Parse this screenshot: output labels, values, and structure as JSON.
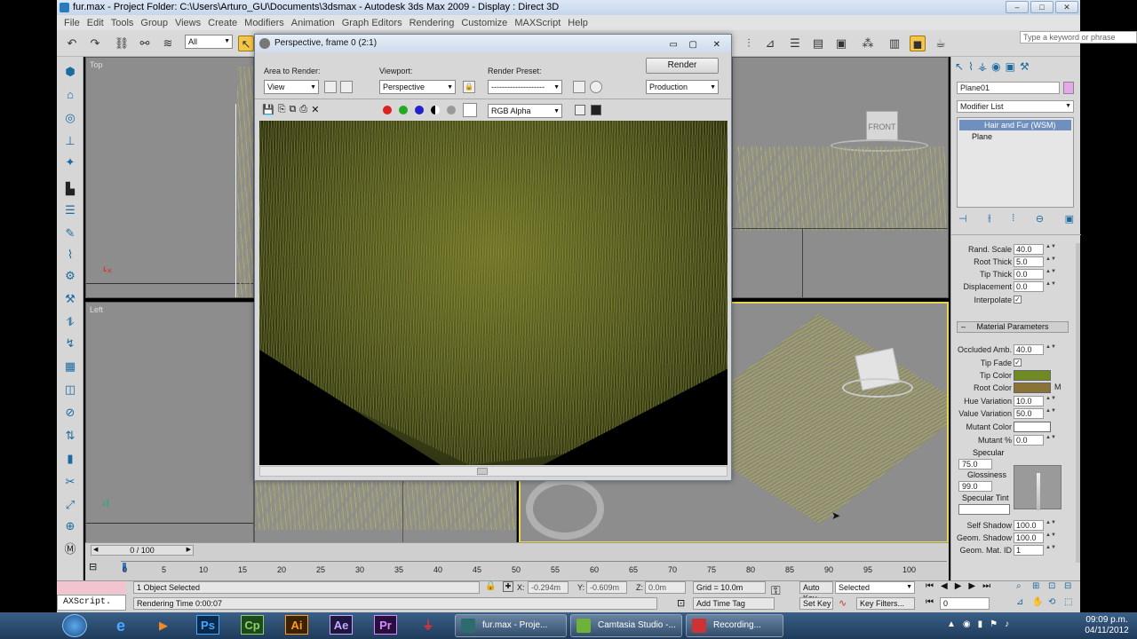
{
  "app": {
    "title": "fur.max     - Project Folder: C:\\Users\\Arturo_GU\\Documents\\3dsmax     - Autodesk 3ds Max  2009       - Display : Direct 3D"
  },
  "menu": [
    "File",
    "Edit",
    "Tools",
    "Group",
    "Views",
    "Create",
    "Modifiers",
    "Animation",
    "Graph Editors",
    "Rendering",
    "Customize",
    "MAXScript",
    "Help"
  ],
  "toolbar": {
    "selection_filter": "All",
    "search_placeholder": "Type a keyword or phrase"
  },
  "viewports": {
    "top_label": "Top",
    "left_label": "Left",
    "front_cube": "FRONT"
  },
  "render_window": {
    "title": "Perspective, frame 0 (2:1)",
    "area_label": "Area to Render:",
    "area_value": "View",
    "viewport_label": "Viewport:",
    "viewport_value": "Perspective",
    "preset_label": "Render Preset:",
    "preset_value": "--------------------",
    "render_button": "Render",
    "production_value": "Production",
    "channel_value": "RGB Alpha"
  },
  "command_panel": {
    "object_name": "Plane01",
    "modifier_list": "Modifier List",
    "stack": [
      "Hair and Fur (WSM)",
      "Plane"
    ],
    "params": [
      {
        "label": "Rand. Scale",
        "value": "40.0"
      },
      {
        "label": "Root Thick",
        "value": "5.0"
      },
      {
        "label": "Tip Thick",
        "value": "0.0"
      },
      {
        "label": "Displacement",
        "value": "0.0"
      }
    ],
    "interpolate_label": "Interpolate",
    "rollout_title": "Material Parameters",
    "occluded_label": "Occluded Amb.",
    "occluded_value": "40.0",
    "tip_fade_label": "Tip Fade",
    "tip_color_label": "Tip Color",
    "root_color_label": "Root Color",
    "root_color_map": "M",
    "hue_label": "Hue Variation",
    "hue_value": "10.0",
    "value_var_label": "Value Variation",
    "value_var_value": "50.0",
    "mutant_color_label": "Mutant Color",
    "mutant_pct_label": "Mutant %",
    "mutant_pct_value": "0.0",
    "specular_label": "Specular",
    "specular_value": "75.0",
    "glossiness_label": "Glossiness",
    "glossiness_value": "99.0",
    "spec_tint_label": "Specular Tint",
    "self_shadow_label": "Self Shadow",
    "self_shadow_value": "100.0",
    "geom_shadow_label": "Geom. Shadow",
    "geom_shadow_value": "100.0",
    "mat_id_label": "Geom. Mat. ID",
    "mat_id_value": "1",
    "colors": {
      "tip": "#6f8a23",
      "root": "#8a7336",
      "mutant": "#ffffff",
      "spec_tint": "#ffffff"
    }
  },
  "timeline": {
    "frame_display": "0 / 100",
    "ticks": [
      "0",
      "5",
      "10",
      "15",
      "20",
      "25",
      "30",
      "35",
      "40",
      "45",
      "50",
      "55",
      "60",
      "65",
      "70",
      "75",
      "80",
      "85",
      "90",
      "95",
      "100"
    ]
  },
  "status": {
    "maxscript": "AXScript.",
    "selection": "1 Object Selected",
    "render_time": "Rendering Time  0:00:07",
    "x_label": "X:",
    "x_value": "-0.294m",
    "y_label": "Y:",
    "y_value": "-0.609m",
    "z_label": "Z:",
    "z_value": "0.0m",
    "grid": "Grid = 10.0m",
    "add_time_tag": "Add Time Tag",
    "auto_key": "Auto Key",
    "selected": "Selected",
    "set_key": "Set Key",
    "key_filters": "Key Filters...",
    "frame": "0"
  },
  "taskbar": {
    "pins": [
      {
        "label": "Ps",
        "color": "#0b2b4d",
        "fg": "#47a6ff"
      },
      {
        "label": "Cp",
        "color": "#1d4a1a",
        "fg": "#8ed16b"
      },
      {
        "label": "Ai",
        "color": "#3d2200",
        "fg": "#ff9a1f"
      },
      {
        "label": "Ae",
        "color": "#1d1640",
        "fg": "#c8a8ff"
      },
      {
        "label": "Pr",
        "color": "#2a0f3d",
        "fg": "#d08cff"
      }
    ],
    "items": [
      "fur.max     - Proje...",
      "Camtasia Studio -...",
      "Recording..."
    ],
    "time": "09:09 p.m.",
    "date": "04/11/2012"
  }
}
